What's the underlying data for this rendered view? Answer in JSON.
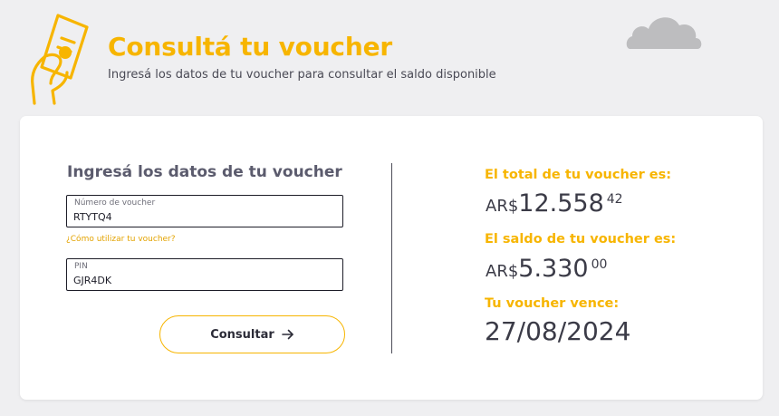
{
  "header": {
    "title": "Consultá tu voucher",
    "subtitle": "Ingresá los datos de tu voucher para consultar el saldo disponible",
    "icons": [
      "hand-holding-voucher-icon",
      "cloud-icon"
    ]
  },
  "form": {
    "heading": "Ingresá los datos de tu voucher",
    "voucher_label": "Número de voucher",
    "voucher_value": "RTYTQ4",
    "help_link": "¿Cómo utilizar tu voucher?",
    "pin_label": "PIN",
    "pin_value": "GJR4DK",
    "submit_label": "Consultar"
  },
  "results": {
    "total_label": "El total de tu voucher es:",
    "total_currency": "AR$",
    "total_integer": "12.558",
    "total_cents": "42",
    "balance_label": "El saldo de tu voucher es:",
    "balance_currency": "AR$",
    "balance_integer": "5.330",
    "balance_cents": "00",
    "expiry_label": "Tu voucher vence:",
    "expiry_date": "27/08/2024"
  },
  "colors": {
    "accent": "#f7b500",
    "background": "#efeff1",
    "text_dark": "#3b3b47",
    "cloud": "#bdbdbf"
  }
}
